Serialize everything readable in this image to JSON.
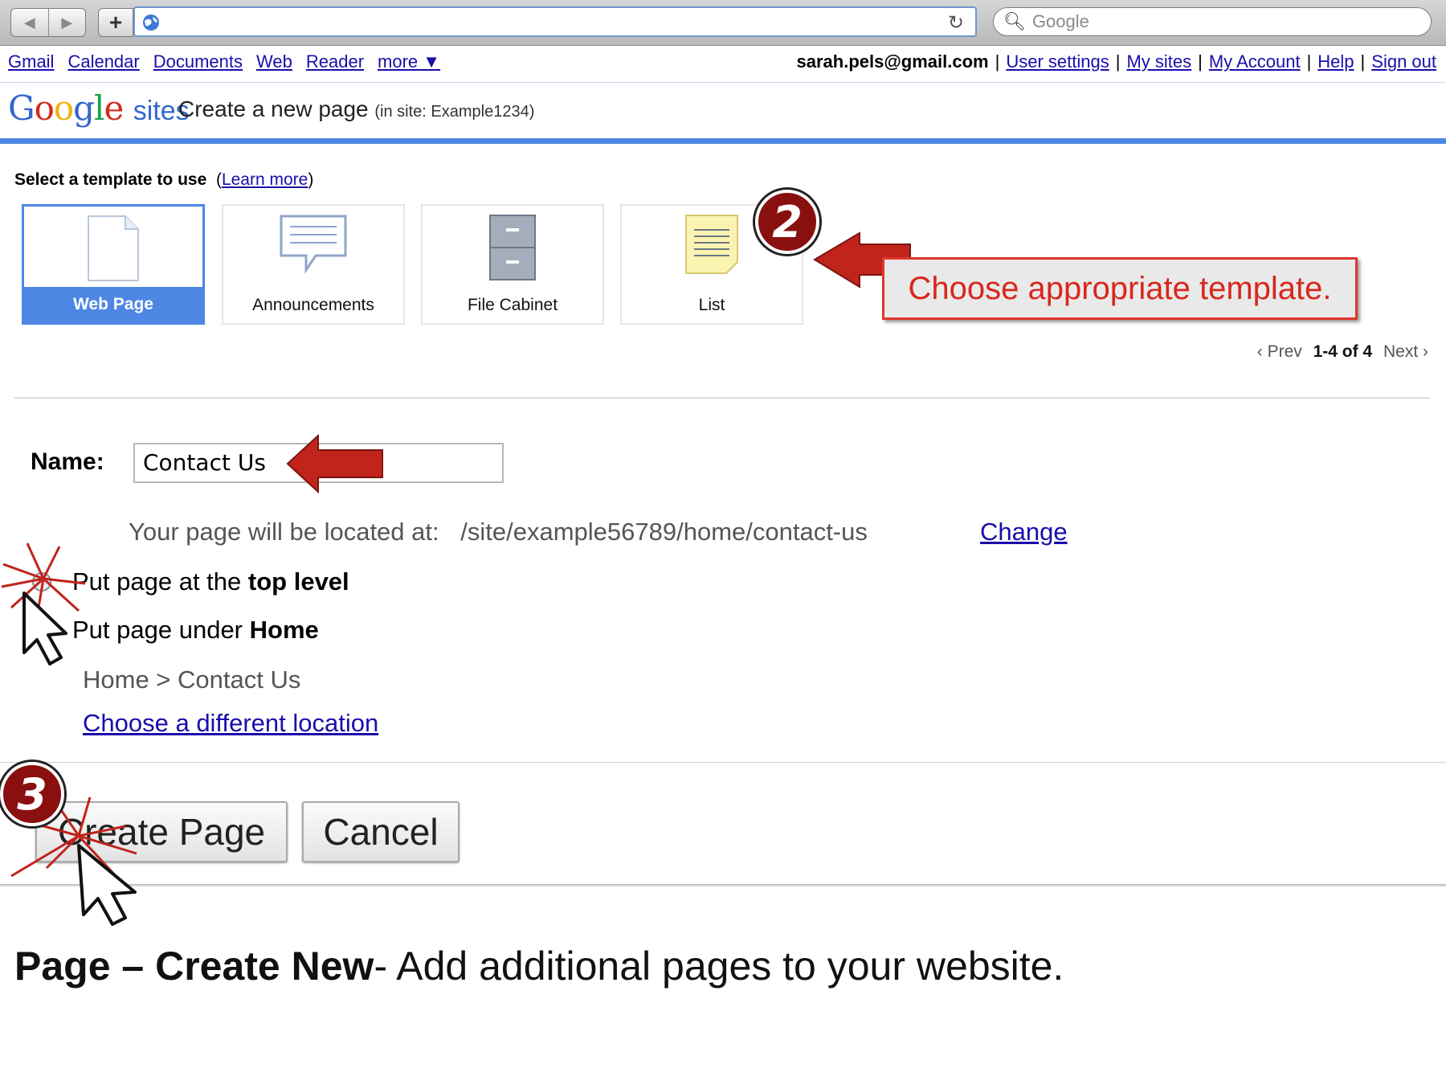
{
  "browser": {
    "back_icon": "back-arrow-icon",
    "forward_icon": "forward-arrow-icon",
    "add_icon": "plus-icon",
    "url": "",
    "search_placeholder": "Google"
  },
  "gbar": {
    "links": [
      "Gmail",
      "Calendar",
      "Documents",
      "Web",
      "Reader",
      "more ▼"
    ],
    "email": "sarah.pels@gmail.com",
    "account_links": [
      "User settings",
      "My sites",
      "My Account",
      "Help",
      "Sign out"
    ]
  },
  "header": {
    "logo_google": "Google",
    "logo_sites": "sites",
    "title": "Create a new page",
    "site_note": "(in site: Example1234)"
  },
  "templates": {
    "label": "Select a template to use",
    "learn_more": "Learn more",
    "items": [
      {
        "label": "Web Page",
        "icon": "document-icon",
        "selected": true
      },
      {
        "label": "Announcements",
        "icon": "speech-bubble-icon",
        "selected": false
      },
      {
        "label": "File Cabinet",
        "icon": "file-cabinet-icon",
        "selected": false
      },
      {
        "label": "List",
        "icon": "list-icon",
        "selected": false
      }
    ],
    "pager": {
      "prev": "‹ Prev",
      "range": "1-4 of 4",
      "next": "Next ›"
    }
  },
  "form": {
    "name_label": "Name:",
    "name_value": "Contact Us",
    "located_prefix": "Your page will be located at:",
    "located_path": "/site/example56789/home/contact-us",
    "change_link": "Change",
    "option_top_prefix": "Put page at the",
    "option_top_bold": "top level",
    "option_under_prefix": "Put page under",
    "option_under_bold": "Home",
    "selected_option": "under",
    "breadcrumb": "Home > Contact Us",
    "different_location": "Choose a different location"
  },
  "actions": {
    "create": "Create Page",
    "cancel": "Cancel"
  },
  "annotations": {
    "badge_2": "2",
    "badge_3": "3",
    "callout": "Choose appropriate template.",
    "caption_bold": "Page – Create New",
    "caption_rest": "- Add additional pages to your website."
  },
  "colors": {
    "accent_blue": "#4d87e3",
    "annotation_red": "#c0241b",
    "link": "#1a0dab"
  }
}
